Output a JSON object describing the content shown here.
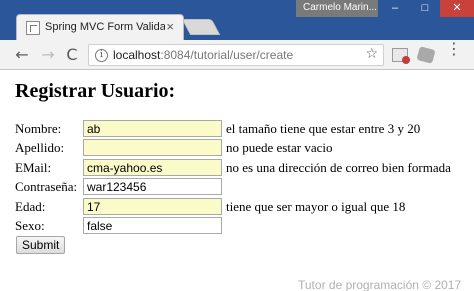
{
  "window": {
    "tab_title": "Spring MVC Form Valida",
    "tab_close": "×",
    "user_name": "Carmelo Marin...",
    "minimize": "–",
    "maximize": "□",
    "close": "✕"
  },
  "toolbar": {
    "back": "←",
    "forward": "→",
    "reload": "C",
    "url_host": "localhost",
    "url_path": ":8084/tutorial/user/create",
    "info_icon": "i",
    "star": "☆",
    "menu": "⋮"
  },
  "page": {
    "heading": "Registrar Usuario:",
    "fields": [
      {
        "label": "Nombre:",
        "value": "ab",
        "error": "el tamaño tiene que estar entre 3 y 20"
      },
      {
        "label": "Apellido:",
        "value": "",
        "error": "no puede estar vacio"
      },
      {
        "label": "EMail:",
        "value": "cma-yahoo.es",
        "error": "no es una dirección de correo bien formada"
      },
      {
        "label": "Contraseña:",
        "value": "war123456",
        "error": ""
      },
      {
        "label": "Edad:",
        "value": "17",
        "error": "tiene que ser mayor o igual que 18"
      },
      {
        "label": "Sexo:",
        "value": "false",
        "error": ""
      }
    ],
    "submit_label": "Submit"
  },
  "watermark": "Tutor de programación © 2017"
}
